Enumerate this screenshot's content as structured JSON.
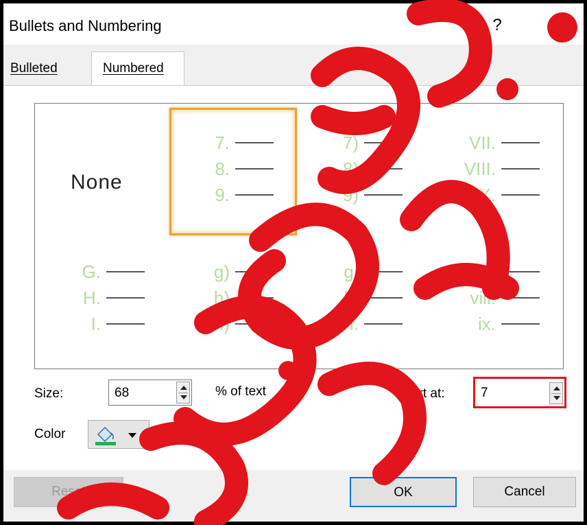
{
  "dialog": {
    "title": "Bullets and Numbering",
    "help_label": "?"
  },
  "tabs": [
    {
      "label": "Bulleted",
      "active": false
    },
    {
      "label": "Numbered",
      "active": true
    }
  ],
  "gallery": {
    "none_label": "None",
    "numbering_color": "#b6dca0",
    "selected_border_color": "#e4a43a",
    "cells": [
      {
        "id": "arabic-period",
        "lines": [
          "7.",
          "8.",
          "9."
        ]
      },
      {
        "id": "arabic-paren",
        "lines": [
          "7)",
          "8)",
          "9)"
        ]
      },
      {
        "id": "upper-roman",
        "lines": [
          "VII.",
          "VIII.",
          "IX."
        ]
      },
      {
        "id": "upper-alpha",
        "lines": [
          "G.",
          "H.",
          "I."
        ]
      },
      {
        "id": "lower-alpha-paren",
        "lines": [
          "g)",
          "h)",
          "i)"
        ]
      },
      {
        "id": "lower-alpha-period",
        "lines": [
          "g.",
          "h.",
          "i."
        ]
      },
      {
        "id": "lower-roman",
        "lines": [
          "vii.",
          "viii.",
          "ix."
        ]
      }
    ],
    "selected": "arabic-period"
  },
  "size": {
    "label": "Size:",
    "value": "68",
    "suffix": "% of text"
  },
  "start_at": {
    "label": "Start at:",
    "value": "7",
    "highlight_color": "#e2141c"
  },
  "color": {
    "label": "Color",
    "swatch": "#22b14c",
    "icon": "paint-bucket-icon"
  },
  "buttons": {
    "reset": "Reset",
    "ok": "OK",
    "cancel": "Cancel"
  },
  "colors": {
    "ok_border": "#0078d7",
    "watermark": "#e2141c"
  }
}
